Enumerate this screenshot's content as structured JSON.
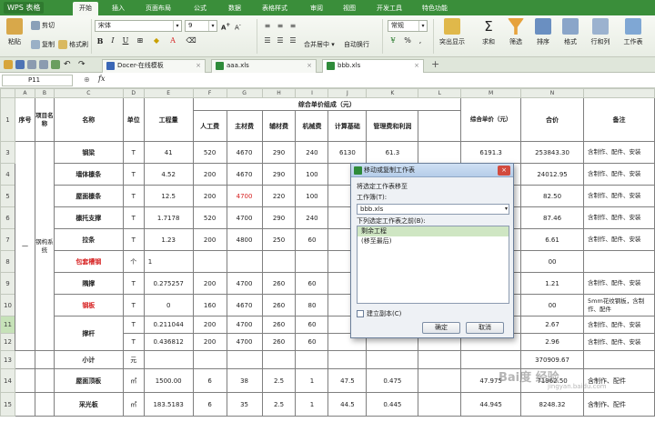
{
  "app": {
    "name": "WPS 表格"
  },
  "menu": [
    "开始",
    "插入",
    "页面布局",
    "公式",
    "数据",
    "表格样式",
    "审阅",
    "视图",
    "开发工具",
    "特色功能"
  ],
  "ribbon": {
    "paste": "粘贴",
    "cut": "剪切",
    "copy": "复制",
    "format_painter": "格式刷",
    "font_name": "宋体",
    "font_size": "9",
    "merge_center": "合并居中",
    "wrap_text": "自动换行",
    "number_format": "常规",
    "cond_format": "突出显示",
    "sum": "求和",
    "filter": "筛选",
    "sort": "排序",
    "format": "格式",
    "rows_cols": "行和列",
    "worksheet": "工作表"
  },
  "doc_tabs": [
    "Docer-在线模板",
    "aaa.xls",
    "bbb.xls"
  ],
  "formula_bar": {
    "cell_ref": "P11",
    "fx": "fx"
  },
  "columns": [
    "A",
    "B",
    "C",
    "D",
    "E",
    "F",
    "G",
    "H",
    "I",
    "J",
    "K",
    "L",
    "M",
    "N"
  ],
  "sheet": {
    "h_seq": "序号",
    "h_project": "项目名称",
    "h_name": "名称",
    "h_unit": "单位",
    "h_qty": "工程量",
    "h_group": "综合单价组成（元）",
    "h_labor": "人工费",
    "h_main": "主材费",
    "h_aux": "辅材费",
    "h_machine": "机械费",
    "h_base": "计算基础",
    "h_mgmt": "管理费和利润",
    "h_unitprice": "综合单价（元）",
    "h_total": "合价",
    "h_note": "备注",
    "section_no": "一",
    "section_name": "钢构系统",
    "rows": [
      {
        "r": "3",
        "name": "钢梁",
        "unit": "T",
        "qty": "41",
        "labor": "520",
        "main": "4670",
        "aux": "290",
        "mach": "240",
        "base": "6130",
        "mgmt": "61.3",
        "price": "6191.3",
        "total": "253843.30",
        "note": "含制作、配件、安装"
      },
      {
        "r": "4",
        "name": "墙体檩条",
        "unit": "T",
        "qty": "4.52",
        "labor": "200",
        "main": "4670",
        "aux": "290",
        "mach": "100",
        "base": "",
        "mgmt": "",
        "price": "",
        "total": "24012.95",
        "note": "含制作、配件、安装"
      },
      {
        "r": "5",
        "name": "屋面檩条",
        "unit": "T",
        "qty": "12.5",
        "labor": "200",
        "main": "4700",
        "aux": "220",
        "mach": "100",
        "base": "",
        "mgmt": "",
        "price": "",
        "total": "82.50",
        "note": "含制作、配件、安装"
      },
      {
        "r": "6",
        "name": "檩托支撑",
        "unit": "T",
        "qty": "1.7178",
        "labor": "520",
        "main": "4700",
        "aux": "290",
        "mach": "240",
        "base": "",
        "mgmt": "",
        "price": "",
        "total": "87.46",
        "note": "含制作、配件、安装"
      },
      {
        "r": "7",
        "name": "拉条",
        "unit": "T",
        "qty": "1.23",
        "labor": "200",
        "main": "4800",
        "aux": "250",
        "mach": "60",
        "base": "",
        "mgmt": "",
        "price": "",
        "total": "6.61",
        "note": "含制作、配件、安装"
      },
      {
        "r": "8",
        "name": "包套槽钢",
        "unit": "个",
        "qty": "1",
        "labor": "",
        "main": "",
        "aux": "",
        "mach": "",
        "base": "",
        "mgmt": "",
        "price": "",
        "total": "00",
        "note": ""
      },
      {
        "r": "9",
        "name": "隅撑",
        "unit": "T",
        "qty": "0.275257",
        "labor": "200",
        "main": "4700",
        "aux": "260",
        "mach": "60",
        "base": "",
        "mgmt": "",
        "price": "",
        "total": "1.21",
        "note": "含制作、配件、安装"
      },
      {
        "r": "10",
        "name": "钢板",
        "unit": "T",
        "qty": "0",
        "labor": "160",
        "main": "4670",
        "aux": "260",
        "mach": "80",
        "base": "",
        "mgmt": "",
        "price": "",
        "total": "00",
        "note": "5mm花纹钢板，含制作、配件"
      },
      {
        "r": "11",
        "name": "撑杆",
        "unit": "T",
        "qty": "0.211044",
        "labor": "200",
        "main": "4700",
        "aux": "260",
        "mach": "60",
        "base": "",
        "mgmt": "",
        "price": "",
        "total": "2.67",
        "note": "含制作、配件、安装"
      },
      {
        "r": "12",
        "name": "",
        "unit": "T",
        "qty": "0.436812",
        "labor": "200",
        "main": "4700",
        "aux": "260",
        "mach": "60",
        "base": "",
        "mgmt": "",
        "price": "",
        "total": "2.96",
        "note": "含制作、配件、安装"
      },
      {
        "r": "13",
        "name": "小计",
        "unit": "元",
        "qty": "",
        "labor": "",
        "main": "",
        "aux": "",
        "mach": "",
        "base": "",
        "mgmt": "",
        "price": "",
        "total": "370909.67",
        "note": ""
      },
      {
        "r": "14",
        "name": "屋面顶板",
        "unit": "㎡",
        "qty": "1500.00",
        "labor": "6",
        "main": "38",
        "aux": "2.5",
        "mach": "1",
        "base": "47.5",
        "mgmt": "0.475",
        "price": "47.975",
        "total": "71962.50",
        "note": "含制作、配件"
      },
      {
        "r": "15",
        "name": "采光板",
        "unit": "㎡",
        "qty": "183.5183",
        "labor": "6",
        "main": "35",
        "aux": "2.5",
        "mach": "1",
        "base": "44.5",
        "mgmt": "0.445",
        "price": "44.945",
        "total": "8248.32",
        "note": "含制作、配件"
      }
    ]
  },
  "dialog": {
    "title": "移动或复制工作表",
    "instruction": "将选定工作表移至",
    "workbook_label": "工作簿(T):",
    "workbook_value": "bbb.xls",
    "before_label": "下列选定工作表之前(B):",
    "sheets": [
      "剩余工程",
      "(移至最后)"
    ],
    "copy_label": "建立副本(C)",
    "ok": "确定",
    "cancel": "取消",
    "close": "×"
  },
  "watermark": {
    "main": "Bai度 经验",
    "sub": "jingyan.baidu.com"
  },
  "colors": {
    "accent": "#3a8e3a",
    "selection": "#cfe6c3",
    "red_text": "#d61f1f"
  }
}
